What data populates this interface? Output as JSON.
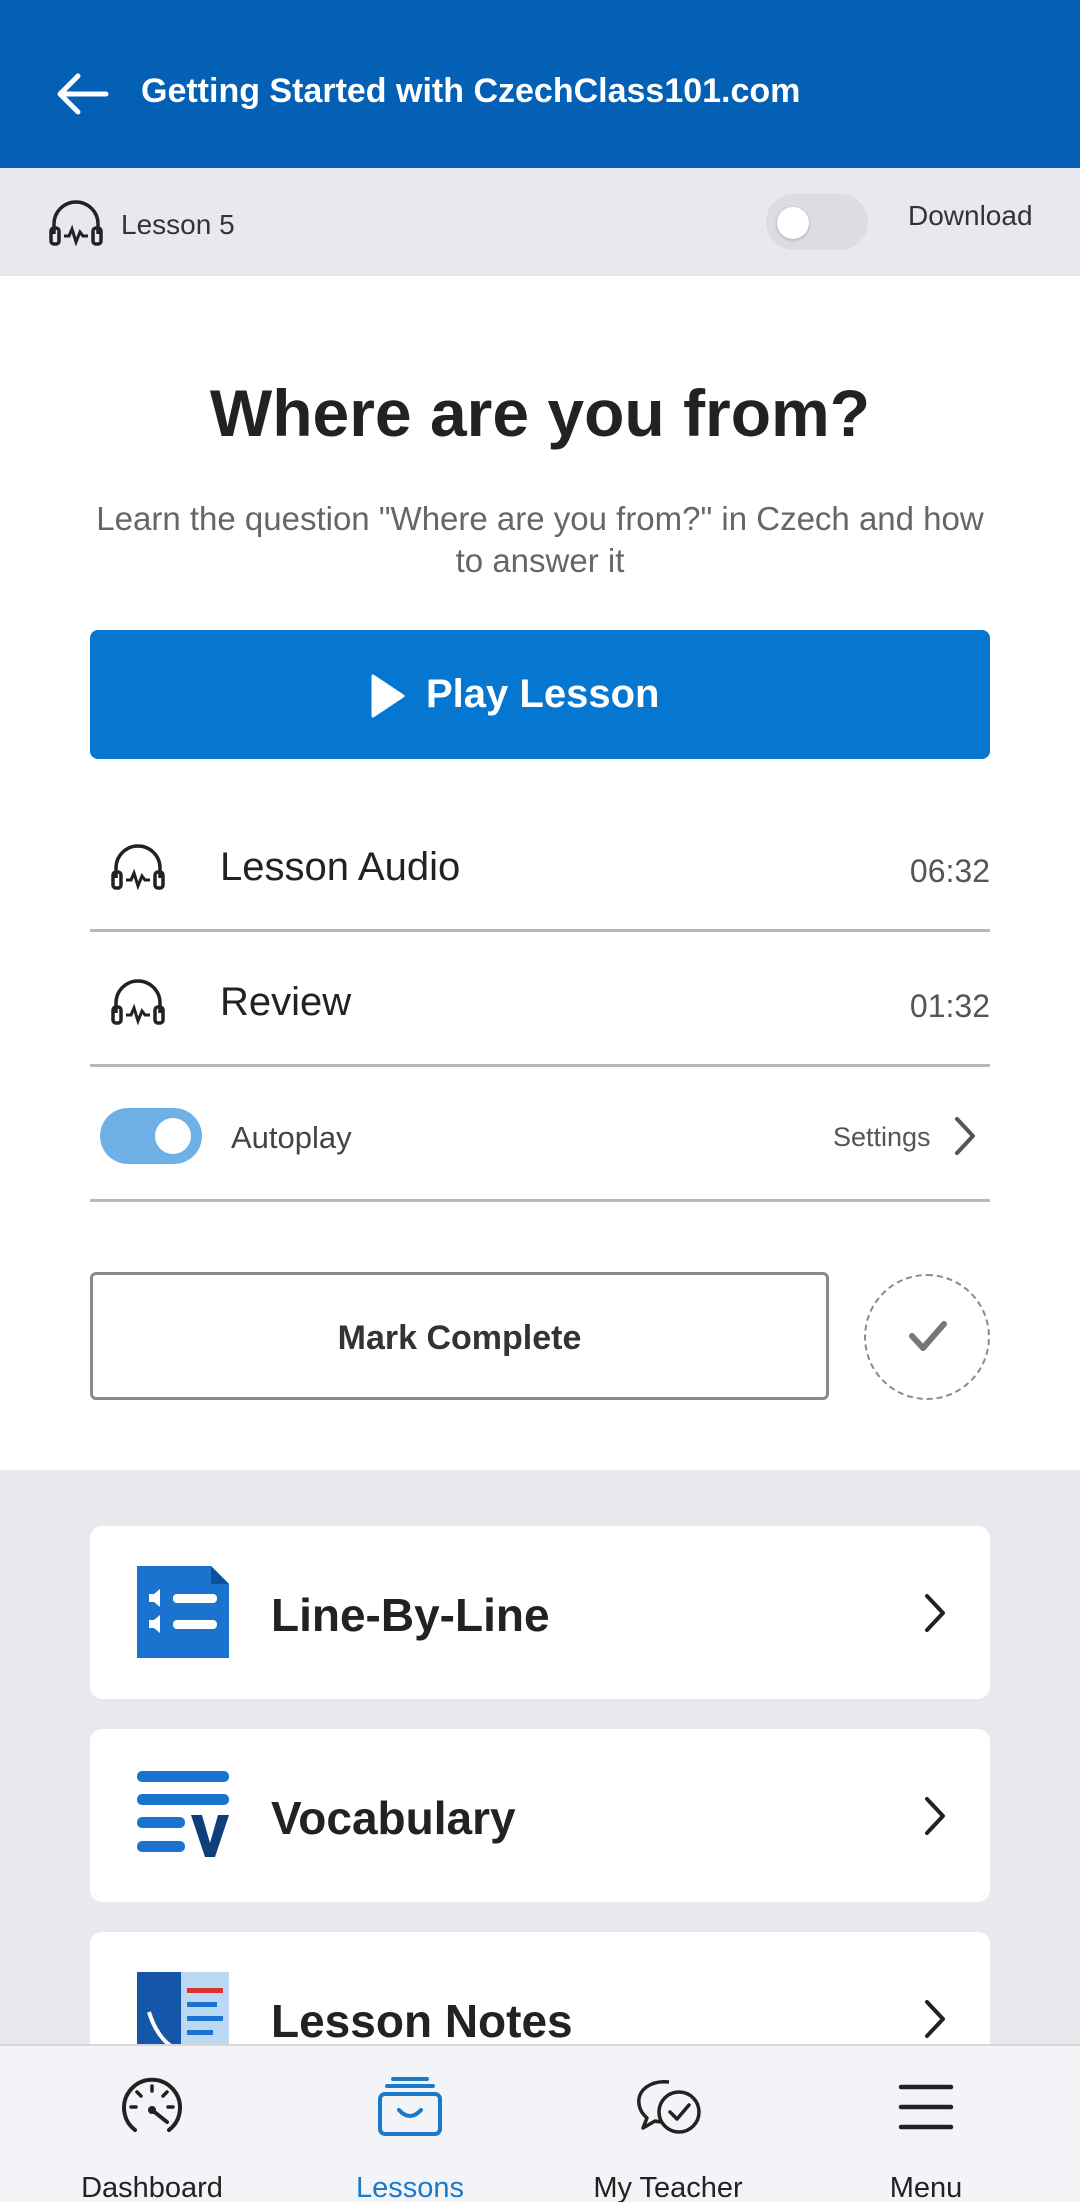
{
  "header": {
    "title": "Getting Started with CzechClass101.com"
  },
  "subbar": {
    "lesson_label": "Lesson 5",
    "download_label": "Download"
  },
  "lesson": {
    "title": "Where are you from?",
    "description": "Learn the question \"Where are you from?\" in Czech and how to answer it",
    "play_label": "Play Lesson"
  },
  "tracks": [
    {
      "title": "Lesson Audio",
      "duration": "06:32"
    },
    {
      "title": "Review",
      "duration": "01:32"
    }
  ],
  "autoplay": {
    "label": "Autoplay",
    "enabled": true,
    "settings_label": "Settings"
  },
  "mark_complete": {
    "label": "Mark Complete"
  },
  "cards": [
    {
      "title": "Line-By-Line",
      "icon": "line-by-line-icon"
    },
    {
      "title": "Vocabulary",
      "icon": "vocabulary-icon"
    },
    {
      "title": "Lesson Notes",
      "icon": "lesson-notes-icon"
    }
  ],
  "nav": [
    {
      "label": "Dashboard",
      "icon": "dashboard-icon",
      "active": false
    },
    {
      "label": "Lessons",
      "icon": "lessons-icon",
      "active": true
    },
    {
      "label": "My Teacher",
      "icon": "my-teacher-icon",
      "active": false
    },
    {
      "label": "Menu",
      "icon": "menu-icon",
      "active": false
    }
  ],
  "colors": {
    "primary": "#0460b4",
    "button": "#0677d1",
    "toggle_on": "#6fb0e6",
    "active_nav": "#1b79cc"
  }
}
